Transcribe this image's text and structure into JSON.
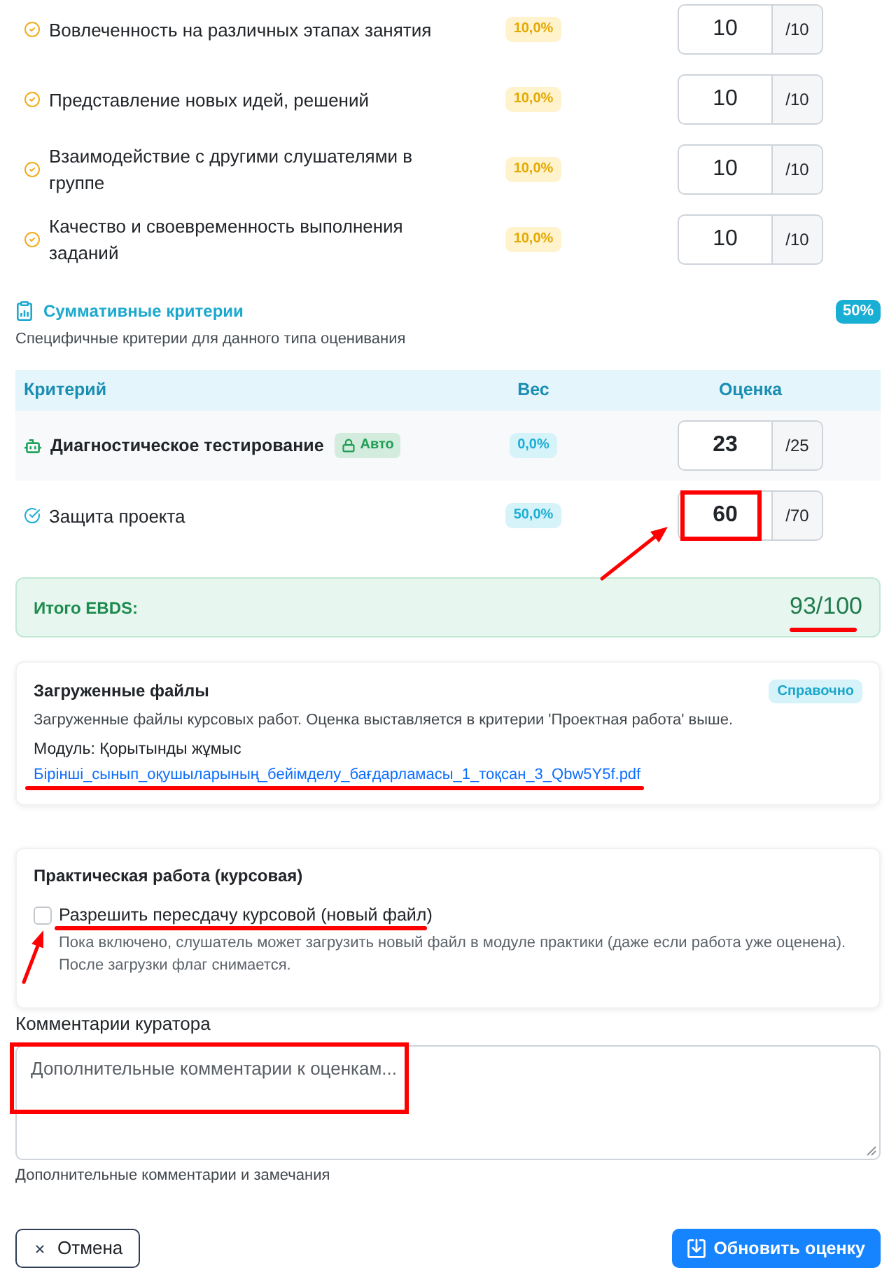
{
  "formative_criteria": [
    {
      "name": "Вовлеченность на различных этапах занятия",
      "weight": "10,0%",
      "score": "10",
      "max": "/10"
    },
    {
      "name": "Представление новых идей, решений",
      "weight": "10,0%",
      "score": "10",
      "max": "/10"
    },
    {
      "name": "Взаимодействие с другими слушателями в группе",
      "weight": "10,0%",
      "score": "10",
      "max": "/10"
    },
    {
      "name": "Качество и своевременность выполнения заданий",
      "weight": "10,0%",
      "score": "10",
      "max": "/10"
    }
  ],
  "summative": {
    "title": "Суммативные критерии",
    "share": "50%",
    "subtitle": "Специфичные критерии для данного типа оценивания",
    "columns": [
      "Критерий",
      "Вес",
      "Оценка"
    ],
    "rows": [
      {
        "kind": "auto",
        "name": "Диагностическое тестирование",
        "tag": "Авто",
        "weight": "0,0%",
        "score": "23",
        "max": "/25"
      },
      {
        "kind": "manual",
        "name": "Защита проекта",
        "weight": "50,0%",
        "score": "60",
        "max": "/70"
      }
    ]
  },
  "total": {
    "label": "Итого EBDS:",
    "value": "93/100"
  },
  "files_card": {
    "title": "Загруженные файлы",
    "badge": "Справочно",
    "description": "Загруженные файлы курсовых работ. Оценка выставляется в критерии 'Проектная работа' выше.",
    "module": "Модуль: Қорытынды жұмыс",
    "file_link": "Бірінші_сынып_оқушыларының_бейімделу_бағдарламасы_1_тоқсан_3_Qbw5Y5f.pdf"
  },
  "practice_card": {
    "title": "Практическая работа (курсовая)",
    "checkbox": {
      "label": "Разрешить пересдачу курсовой (новый файл)",
      "checked": false
    },
    "help": [
      "Пока включено, слушатель может загрузить новый файл в модуле практики (даже если работа уже оценена).",
      "После загрузки флаг снимается."
    ]
  },
  "comments": {
    "label": "Комментарии куратора",
    "placeholder": "Дополнительные комментарии к оценкам...",
    "hint": "Дополнительные комментарии и замечания"
  },
  "buttons": [
    {
      "kind": "cancel",
      "label": "Отмена"
    },
    {
      "kind": "submit",
      "label": "Обновить оценку"
    }
  ]
}
